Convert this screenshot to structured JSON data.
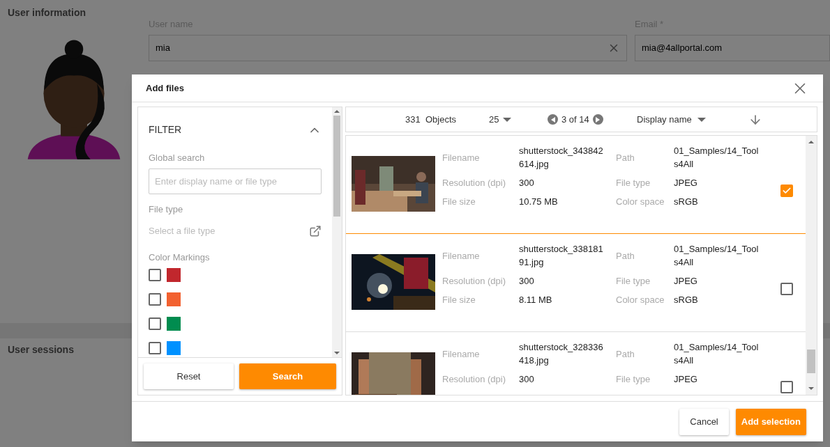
{
  "page": {
    "section_title": "User information",
    "user_name": {
      "label": "User name",
      "value": "mia"
    },
    "email": {
      "label": "Email *",
      "value": "mia@4allportal.com"
    },
    "sessions_title": "User sessions"
  },
  "dialog": {
    "title": "Add files",
    "filter": {
      "title": "FILTER",
      "expanded": true,
      "global_search": {
        "label": "Global search",
        "placeholder": "Enter display name or file type"
      },
      "file_type": {
        "label": "File type",
        "placeholder": "Select a file type"
      },
      "color_markings_label": "Color Markings",
      "colors": [
        {
          "color": "#c1272d",
          "checked": false
        },
        {
          "color": "#f26130",
          "checked": false
        },
        {
          "color": "#008c4f",
          "checked": false
        },
        {
          "color": "#0091ff",
          "checked": false
        }
      ],
      "reset": "Reset",
      "search": "Search"
    },
    "toolbar": {
      "count": "331",
      "count_label": "Objects",
      "page_size": "25",
      "page": "3 of 14",
      "sort": "Display name"
    },
    "items": [
      {
        "selected": true,
        "fields": [
          {
            "label": "Filename",
            "value": "shutterstock_343842614.jpg"
          },
          {
            "label": "Path",
            "value": "01_Samples/14_Tools4All"
          },
          {
            "label": "Resolution (dpi)",
            "value": "300"
          },
          {
            "label": "File type",
            "value": "JPEG"
          },
          {
            "label": "File size",
            "value": "10.75 MB"
          },
          {
            "label": "Color space",
            "value": "sRGB"
          }
        ]
      },
      {
        "selected": false,
        "fields": [
          {
            "label": "Filename",
            "value": "shutterstock_33818191.jpg"
          },
          {
            "label": "Path",
            "value": "01_Samples/14_Tools4All"
          },
          {
            "label": "Resolution (dpi)",
            "value": "300"
          },
          {
            "label": "File type",
            "value": "JPEG"
          },
          {
            "label": "File size",
            "value": "8.11 MB"
          },
          {
            "label": "Color space",
            "value": "sRGB"
          }
        ]
      },
      {
        "selected": false,
        "fields": [
          {
            "label": "Filename",
            "value": "shutterstock_328336418.jpg"
          },
          {
            "label": "Path",
            "value": "01_Samples/14_Tools4All"
          },
          {
            "label": "Resolution (dpi)",
            "value": "300"
          },
          {
            "label": "File type",
            "value": "JPEG"
          }
        ]
      }
    ],
    "cancel": "Cancel",
    "add": "Add selection"
  }
}
